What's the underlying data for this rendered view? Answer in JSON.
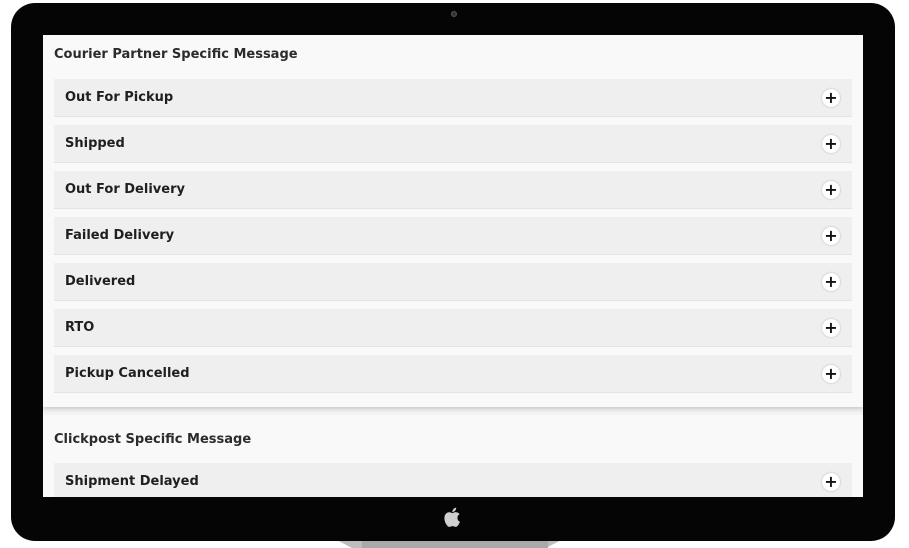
{
  "courier_section": {
    "title": "Courier Partner Specific Message",
    "items": [
      {
        "label": "Out For Pickup"
      },
      {
        "label": "Shipped"
      },
      {
        "label": "Out For Delivery"
      },
      {
        "label": "Failed Delivery"
      },
      {
        "label": "Delivered"
      },
      {
        "label": "RTO"
      },
      {
        "label": "Pickup Cancelled"
      }
    ]
  },
  "clickpost_section": {
    "title": "Clickpost Specific Message",
    "items": [
      {
        "label": "Shipment Delayed"
      }
    ]
  },
  "icons": {
    "expand": "plus-icon",
    "brand": "apple-logo-icon",
    "camera": "camera-icon"
  },
  "glyphs": {
    "expand": "+"
  }
}
